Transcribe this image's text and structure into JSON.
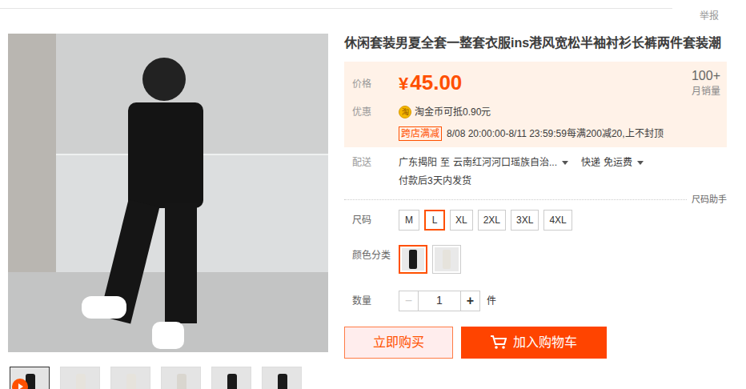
{
  "report": "举报",
  "product": {
    "title": "休闲套装男夏全套一整套衣服ins港风宽松半袖衬衫长裤两件套装潮"
  },
  "price": {
    "label": "价格",
    "symbol": "¥",
    "value": "45.00",
    "sales_count": "100+",
    "sales_label": "月销量"
  },
  "promo": {
    "label": "优惠",
    "coin_icon": "淘",
    "coin_text": "淘金币可抵0.90元",
    "badge": "跨店满减",
    "detail": "8/08 20:00:00-8/11 23:59:59每满200减20,上不封顶"
  },
  "delivery": {
    "label": "配送",
    "origin": "广东揭阳",
    "to": "至",
    "destination": "云南红河河口瑶族自治...",
    "shipping": "快递",
    "fee": "免运费",
    "dispatch": "付款后3天内发货"
  },
  "size_helper": "尺码助手",
  "sizes": {
    "label": "尺码",
    "options": [
      {
        "label": "M",
        "selected": false
      },
      {
        "label": "L",
        "selected": true
      },
      {
        "label": "XL",
        "selected": false
      },
      {
        "label": "2XL",
        "selected": false
      },
      {
        "label": "3XL",
        "selected": false
      },
      {
        "label": "4XL",
        "selected": false
      }
    ]
  },
  "colors": {
    "label": "颜色分类",
    "options": [
      {
        "selected": true,
        "color": "#1a1a1a"
      },
      {
        "selected": false,
        "color": "#e6e3dc"
      }
    ]
  },
  "quantity": {
    "label": "数量",
    "minus": "−",
    "plus": "+",
    "value": "1",
    "unit": "件",
    "minus_disabled": true
  },
  "buttons": {
    "buy": "立即购买",
    "cart": "加入购物车"
  },
  "thumbnails": [
    {
      "kind": "video",
      "color": "#1a1a1a"
    },
    {
      "kind": "image",
      "color": "#e6e3dc"
    },
    {
      "kind": "image",
      "color": "#e6e3dc"
    },
    {
      "kind": "image",
      "color": "#d9d6cf"
    },
    {
      "kind": "image",
      "color": "#1a1a1a"
    },
    {
      "kind": "image",
      "color": "#1a1a1a"
    }
  ]
}
